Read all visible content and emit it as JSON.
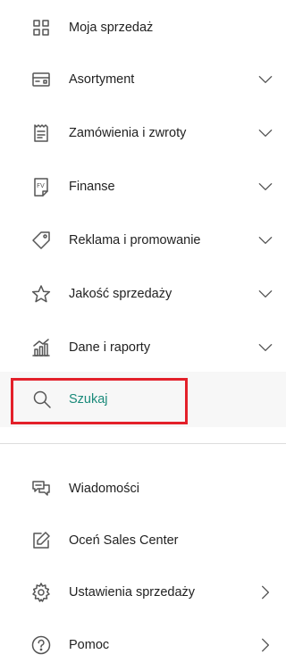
{
  "menu": {
    "items": [
      {
        "label": "Moja sprzedaż",
        "icon": "dashboard-grid-icon",
        "expandable": false
      },
      {
        "label": "Asortyment",
        "icon": "box-icon",
        "expandable": true
      },
      {
        "label": "Zamówienia i zwroty",
        "icon": "receipt-icon",
        "expandable": true
      },
      {
        "label": "Finanse",
        "icon": "invoice-fv-icon",
        "expandable": true
      },
      {
        "label": "Reklama i promowanie",
        "icon": "price-tag-icon",
        "expandable": true
      },
      {
        "label": "Jakość sprzedaży",
        "icon": "star-icon",
        "expandable": true
      },
      {
        "label": "Dane i raporty",
        "icon": "chart-icon",
        "expandable": true
      },
      {
        "label": "Szukaj",
        "icon": "search-icon",
        "expandable": false,
        "active": true
      }
    ],
    "bottom_items": [
      {
        "label": "Wiadomości",
        "icon": "chat-icon",
        "expandable": false
      },
      {
        "label": "Oceń Sales Center",
        "icon": "edit-icon",
        "expandable": false
      },
      {
        "label": "Ustawienia sprzedaży",
        "icon": "gear-icon",
        "expandable": true
      },
      {
        "label": "Pomoc",
        "icon": "help-icon",
        "expandable": true
      }
    ]
  },
  "colors": {
    "active_text": "#1a8a7a",
    "highlight_border": "#e3202a",
    "icon": "#555555"
  }
}
